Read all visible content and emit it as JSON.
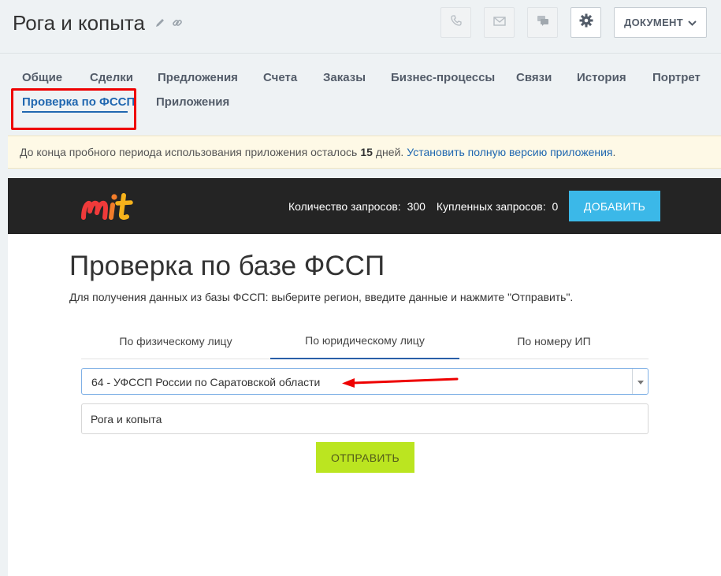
{
  "header": {
    "title": "Рога и копыта",
    "document_label": "ДОКУМЕНТ"
  },
  "tabs": [
    {
      "label": "Общие"
    },
    {
      "label": "Сделки"
    },
    {
      "label": "Предложения"
    },
    {
      "label": "Счета"
    },
    {
      "label": "Заказы"
    },
    {
      "label": "Бизнес-процессы"
    },
    {
      "label": "Связи"
    },
    {
      "label": "История"
    },
    {
      "label": "Портрет"
    },
    {
      "label": "Проверка по ФССП",
      "active": true
    },
    {
      "label": "Приложения"
    }
  ],
  "notice": {
    "text_before": "До конца пробного периода использования приложения осталось",
    "days": "15",
    "text_after": "дней.",
    "link": "Установить полную версию приложения",
    "link_after": "."
  },
  "app": {
    "requests_label": "Количество запросов:",
    "requests_value": "300",
    "purchased_label": "Купленных запросов:",
    "purchased_value": "0",
    "add_label": "ДОБАВИТЬ",
    "heading": "Проверка по базе ФССП",
    "description": "Для получения данных из базы ФССП: выберите регион, введите данные и нажмите \"Отправить\".",
    "subtabs": [
      {
        "label": "По физическому лицу"
      },
      {
        "label": "По юридическому лицу",
        "active": true
      },
      {
        "label": "По номеру ИП"
      }
    ],
    "region_value": "64 - УФССП России по Саратовской области",
    "company_value": "Рога и копыта",
    "send_label": "ОТПРАВИТЬ"
  },
  "colors": {
    "accent": "#2067b0",
    "add_button": "#3bb8e8",
    "send_button": "#bbe520",
    "annotation": "#e00000"
  },
  "icons": [
    "pencil-icon",
    "link-icon",
    "phone-icon",
    "mail-icon",
    "chat-icon",
    "gear-icon",
    "chevron-down-icon",
    "mit-logo"
  ]
}
